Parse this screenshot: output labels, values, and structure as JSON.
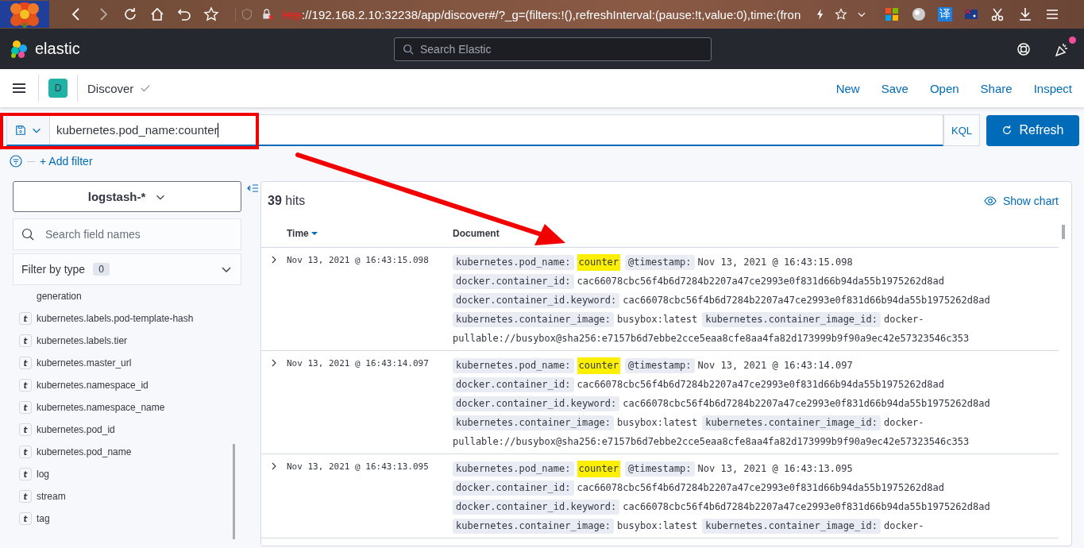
{
  "browser": {
    "url_scheme": "http",
    "url_rest": "://192.168.2.10:32238/app/discover#/?_g=(filters:!(),refreshInterval:(pause:!t,value:0),time:(fron",
    "translate_label": "译"
  },
  "header": {
    "logo": "elastic",
    "search_placeholder": "Search Elastic",
    "notification": true
  },
  "nav": {
    "space": "D",
    "app": "Discover",
    "actions": [
      "New",
      "Save",
      "Open",
      "Share",
      "Inspect"
    ]
  },
  "query": {
    "value": "kubernetes.pod_name:counter",
    "language": "KQL",
    "refresh": "Refresh",
    "highlighted": true
  },
  "filter": {
    "add": "+ Add filter"
  },
  "sidebar": {
    "index_pattern": "logstash-*",
    "search_placeholder": "Search field names",
    "filter_label": "Filter by type",
    "filter_count": "0",
    "fields": [
      {
        "kind": "partial",
        "name": "generation"
      },
      {
        "kind": "field",
        "type": "t",
        "name": "kubernetes.labels.pod-template-hash"
      },
      {
        "kind": "field",
        "type": "t",
        "name": "kubernetes.labels.tier"
      },
      {
        "kind": "field",
        "type": "t",
        "name": "kubernetes.master_url"
      },
      {
        "kind": "field",
        "type": "t",
        "name": "kubernetes.namespace_id"
      },
      {
        "kind": "field",
        "type": "t",
        "name": "kubernetes.namespace_name"
      },
      {
        "kind": "field",
        "type": "t",
        "name": "kubernetes.pod_id"
      },
      {
        "kind": "field",
        "type": "t",
        "name": "kubernetes.pod_name"
      },
      {
        "kind": "field",
        "type": "t",
        "name": "log"
      },
      {
        "kind": "field",
        "type": "t",
        "name": "stream"
      },
      {
        "kind": "field",
        "type": "t",
        "name": "tag"
      }
    ]
  },
  "results": {
    "count": "39",
    "count_label": "hits",
    "show_chart": "Show chart",
    "columns": [
      "Time",
      "Document"
    ],
    "rows": [
      {
        "time": "Nov 13, 2021 @ 16:43:15.098",
        "lines": [
          [
            {
              "key": "kubernetes.pod_name:",
              "value": "counter",
              "highlighted": true
            },
            {
              "key": "@timestamp:",
              "value": "Nov 13, 2021 @ 16:43:15.098",
              "highlighted": false
            }
          ],
          [
            {
              "key": "docker.container_id:",
              "value": "cac66078cbc56f4b6d7284b2207a47ce2993e0f831d66b94da55b1975262d8ad",
              "highlighted": false
            }
          ],
          [
            {
              "key": "docker.container_id.keyword:",
              "value": "cac66078cbc56f4b6d7284b2207a47ce2993e0f831d66b94da55b1975262d8ad",
              "highlighted": false
            }
          ],
          [
            {
              "key": "kubernetes.container_image:",
              "value": "busybox:latest",
              "highlighted": false
            },
            {
              "key": "kubernetes.container_image_id:",
              "value": "docker-",
              "highlighted": false
            }
          ],
          [
            {
              "value": "pullable://busybox@sha256:e7157b6d7ebbe2cce5eaa8cfe8aa4fa82d173999b9f90a9ec42e57323546c353",
              "highlighted": false
            }
          ]
        ]
      },
      {
        "time": "Nov 13, 2021 @ 16:43:14.097",
        "lines": [
          [
            {
              "key": "kubernetes.pod_name:",
              "value": "counter",
              "highlighted": true
            },
            {
              "key": "@timestamp:",
              "value": "Nov 13, 2021 @ 16:43:14.097",
              "highlighted": false
            }
          ],
          [
            {
              "key": "docker.container_id:",
              "value": "cac66078cbc56f4b6d7284b2207a47ce2993e0f831d66b94da55b1975262d8ad",
              "highlighted": false
            }
          ],
          [
            {
              "key": "docker.container_id.keyword:",
              "value": "cac66078cbc56f4b6d7284b2207a47ce2993e0f831d66b94da55b1975262d8ad",
              "highlighted": false
            }
          ],
          [
            {
              "key": "kubernetes.container_image:",
              "value": "busybox:latest",
              "highlighted": false
            },
            {
              "key": "kubernetes.container_image_id:",
              "value": "docker-",
              "highlighted": false
            }
          ],
          [
            {
              "value": "pullable://busybox@sha256:e7157b6d7ebbe2cce5eaa8cfe8aa4fa82d173999b9f90a9ec42e57323546c353",
              "highlighted": false
            }
          ]
        ]
      },
      {
        "time": "Nov 13, 2021 @ 16:43:13.095",
        "lines": [
          [
            {
              "key": "kubernetes.pod_name:",
              "value": "counter",
              "highlighted": true
            },
            {
              "key": "@timestamp:",
              "value": "Nov 13, 2021 @ 16:43:13.095",
              "highlighted": false
            }
          ],
          [
            {
              "key": "docker.container_id:",
              "value": "cac66078cbc56f4b6d7284b2207a47ce2993e0f831d66b94da55b1975262d8ad",
              "highlighted": false
            }
          ],
          [
            {
              "key": "docker.container_id.keyword:",
              "value": "cac66078cbc56f4b6d7284b2207a47ce2993e0f831d66b94da55b1975262d8ad",
              "highlighted": false
            }
          ],
          [
            {
              "key": "kubernetes.container_image:",
              "value": "busybox:latest",
              "highlighted": false
            },
            {
              "key": "kubernetes.container_image_id:",
              "value": "docker-",
              "highlighted": false
            }
          ]
        ]
      }
    ]
  },
  "annotation": {
    "arrow": true
  }
}
